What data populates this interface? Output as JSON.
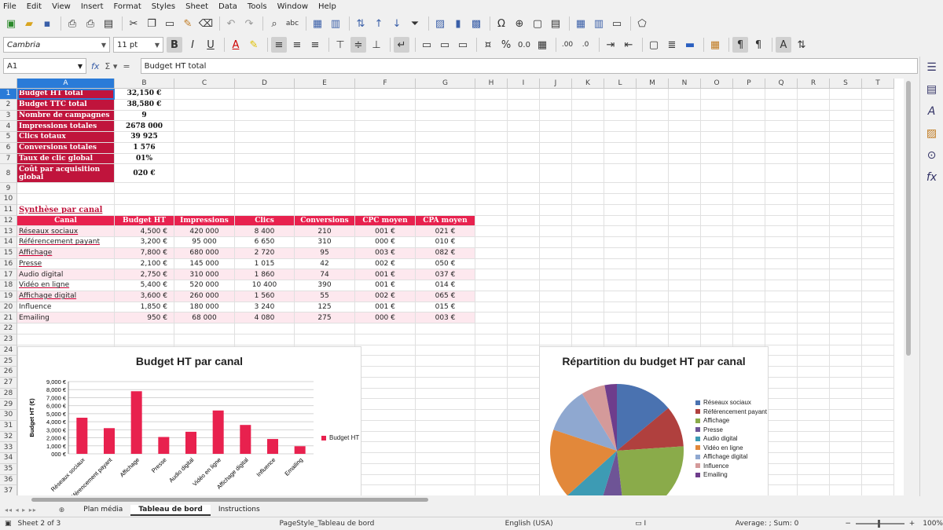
{
  "menu": [
    "File",
    "Edit",
    "View",
    "Insert",
    "Format",
    "Styles",
    "Sheet",
    "Data",
    "Tools",
    "Window",
    "Help"
  ],
  "toolbar": {
    "font_name": "Cambria",
    "font_size": "11 pt"
  },
  "formula_bar": {
    "cell_ref": "A1",
    "content": "Budget HT total"
  },
  "columns": [
    "A",
    "B",
    "C",
    "D",
    "E",
    "F",
    "G",
    "H",
    "I",
    "J",
    "K",
    "L",
    "M",
    "N",
    "O",
    "P",
    "Q",
    "R",
    "S",
    "T"
  ],
  "summary": [
    {
      "label": "Budget HT total",
      "value": "32,150 €"
    },
    {
      "label": "Budget TTC total",
      "value": "38,580 €"
    },
    {
      "label": "Nombre de campagnes",
      "value": "9"
    },
    {
      "label": "Impressions totales",
      "value": "2678 000"
    },
    {
      "label": "Clics totaux",
      "value": "39 925"
    },
    {
      "label": "Conversions totales",
      "value": "1 576"
    },
    {
      "label": "Taux de clic global",
      "value": "01%"
    },
    {
      "label": "Coût par acquisition global",
      "value": "020 €"
    }
  ],
  "section_title": "Synthèse par canal",
  "table": {
    "headers": [
      "Canal",
      "Budget HT",
      "Impressions",
      "Clics",
      "Conversions",
      "CPC moyen",
      "CPA moyen"
    ],
    "rows": [
      [
        "Réseaux sociaux",
        "4,500 €",
        "420 000",
        "8 400",
        "210",
        "001 €",
        "021 €"
      ],
      [
        "Référencement payant",
        "3,200 €",
        "95 000",
        "6 650",
        "310",
        "000 €",
        "010 €"
      ],
      [
        "Affichage",
        "7,800 €",
        "680 000",
        "2 720",
        "95",
        "003 €",
        "082 €"
      ],
      [
        "Presse",
        "2,100 €",
        "145 000",
        "1 015",
        "42",
        "002 €",
        "050 €"
      ],
      [
        "Audio digital",
        "2,750 €",
        "310 000",
        "1 860",
        "74",
        "001 €",
        "037 €"
      ],
      [
        "Vidéo en ligne",
        "5,400 €",
        "520 000",
        "10 400",
        "390",
        "001 €",
        "014 €"
      ],
      [
        "Affichage digital",
        "3,600 €",
        "260 000",
        "1 560",
        "55",
        "002 €",
        "065 €"
      ],
      [
        "Influence",
        "1,850 €",
        "180 000",
        "3 240",
        "125",
        "001 €",
        "015 €"
      ],
      [
        "Emailing",
        "950 €",
        "68 000",
        "4 080",
        "275",
        "000 €",
        "003 €"
      ]
    ]
  },
  "chart_data": [
    {
      "type": "bar",
      "title": "Budget HT par canal",
      "ylabel": "Budget HT (€)",
      "xlabel": "",
      "categories": [
        "Réseaux sociaux",
        "Référencement payant",
        "Affichage",
        "Presse",
        "Audio digital",
        "Vidéo en ligne",
        "Affichage digital",
        "Influence",
        "Emailing"
      ],
      "series": [
        {
          "name": "Budget HT",
          "values": [
            4500,
            3200,
            7800,
            2100,
            2750,
            5400,
            3600,
            1850,
            950
          ],
          "color": "#e8214e"
        }
      ],
      "ylim": [
        0,
        9000
      ],
      "yticks": [
        "000 €",
        "1,000 €",
        "2,000 €",
        "3,000 €",
        "4,000 €",
        "5,000 €",
        "6,000 €",
        "7,000 €",
        "8,000 €",
        "9,000 €"
      ],
      "grid": true,
      "legend": "right"
    },
    {
      "type": "pie",
      "title": "Répartition du budget HT par canal",
      "categories": [
        "Réseaux sociaux",
        "Référencement payant",
        "Affichage",
        "Presse",
        "Audio digital",
        "Vidéo en ligne",
        "Affichage digital",
        "Influence",
        "Emailing"
      ],
      "values": [
        4500,
        3200,
        7800,
        2100,
        2750,
        5400,
        3600,
        1850,
        950
      ],
      "colors": [
        "#4a72b0",
        "#b0403e",
        "#8aab4a",
        "#6e5496",
        "#3d9bb4",
        "#e2883a",
        "#8fa8d0",
        "#d49a9a",
        "#6e3d8c"
      ],
      "legend": "right"
    }
  ],
  "sheet_tabs": [
    "Plan média",
    "Tableau de bord",
    "Instructions"
  ],
  "active_tab": "Tableau de bord",
  "status": {
    "sheet": "Sheet 2 of 3",
    "page_style": "PageStyle_Tableau de bord",
    "language": "English (USA)",
    "summary": "Average: ; Sum: 0",
    "zoom": "100%"
  }
}
